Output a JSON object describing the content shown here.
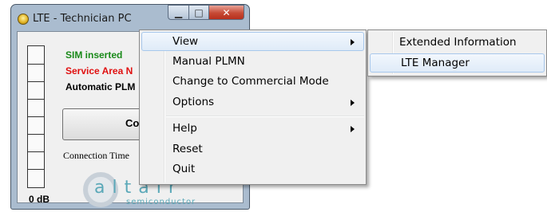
{
  "window": {
    "title": "LTE - Technician PC",
    "caption": {
      "minimize": "▁",
      "maximize": "□",
      "close": "✕"
    },
    "status": {
      "sim": "SIM inserted",
      "service": "Service Area N",
      "plmn": "Automatic PLM"
    },
    "connect_label": "Co",
    "connection_time_label": "Connection Time",
    "signal_label": "0 dB",
    "logo": {
      "word": "altair",
      "sub": "semiconductor"
    },
    "colors": {
      "sim": "#1a8a1a",
      "service": "#e01010",
      "logo": "#5aa8b8"
    }
  },
  "context_menu": {
    "items": [
      {
        "label": "View",
        "submenu": true,
        "highlighted": true
      },
      {
        "label": "Manual PLMN"
      },
      {
        "label": "Change to Commercial Mode"
      },
      {
        "label": "Options",
        "submenu": true
      },
      {
        "label": "Help",
        "submenu": true
      },
      {
        "label": "Reset"
      },
      {
        "label": "Quit"
      }
    ]
  },
  "view_submenu": {
    "items": [
      {
        "label": "Extended Information"
      },
      {
        "label": "LTE Manager",
        "highlighted": true
      }
    ]
  }
}
